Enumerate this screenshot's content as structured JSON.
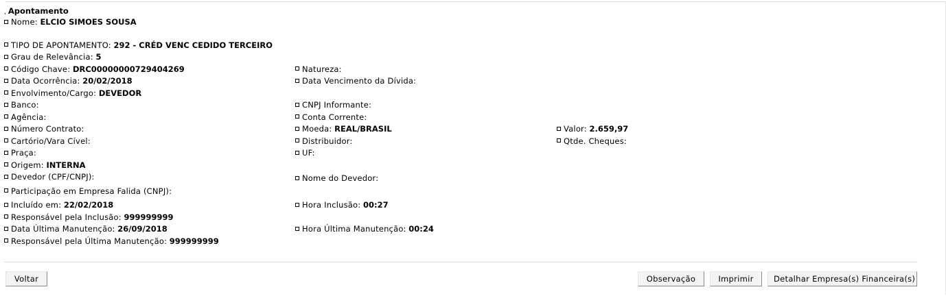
{
  "section_title": "Apontamento",
  "nome": {
    "label": "Nome:",
    "value": "ELCIO SIMOES SOUSA"
  },
  "tipo": {
    "label": "TIPO DE APONTAMENTO:",
    "value": "292 - CRÉD VENC CEDIDO TERCEIRO"
  },
  "grau": {
    "label": "Grau de Relevância:",
    "value": "5"
  },
  "codigo": {
    "label": "Código Chave:",
    "value": "DRC00000000729404269"
  },
  "natureza": {
    "label": "Natureza:",
    "value": ""
  },
  "data_ocorrencia": {
    "label": "Data Ocorrência:",
    "value": "20/02/2018"
  },
  "data_vencimento": {
    "label": "Data Vencimento da Dívida:",
    "value": ""
  },
  "envolvimento": {
    "label": "Envolvimento/Cargo:",
    "value": "DEVEDOR"
  },
  "banco": {
    "label": "Banco:",
    "value": ""
  },
  "cnpj_informante": {
    "label": "CNPJ Informante:",
    "value": ""
  },
  "agencia": {
    "label": "Agência:",
    "value": ""
  },
  "conta_corrente": {
    "label": "Conta Corrente:",
    "value": ""
  },
  "numero_contrato": {
    "label": "Número Contrato:",
    "value": ""
  },
  "moeda": {
    "label": "Moeda:",
    "value": "REAL/BRASIL"
  },
  "valor": {
    "label": "Valor:",
    "value": "2.659,97"
  },
  "cartorio": {
    "label": "Cartório/Vara Cível:",
    "value": ""
  },
  "distribuidor": {
    "label": "Distribuidor:",
    "value": ""
  },
  "qtde_cheques": {
    "label": "Qtde. Cheques:",
    "value": ""
  },
  "praca": {
    "label": "Praça:",
    "value": ""
  },
  "uf": {
    "label": "UF:",
    "value": ""
  },
  "origem": {
    "label": "Origem:",
    "value": "INTERNA"
  },
  "devedor_cpf": {
    "label": "Devedor (CPF/CNPJ):",
    "value": ""
  },
  "nome_devedor": {
    "label": "Nome do Devedor:",
    "value": ""
  },
  "participacao": {
    "label": "Participação em Empresa Falida (CNPJ):",
    "value": ""
  },
  "incluido_em": {
    "label": "Incluído em:",
    "value": "22/02/2018"
  },
  "hora_inclusao": {
    "label": "Hora Inclusão:",
    "value": "00:27"
  },
  "resp_inclusao": {
    "label": "Responsável pela Inclusão:",
    "value": "999999999"
  },
  "data_ultima_manut": {
    "label": "Data Última Manutenção:",
    "value": "26/09/2018"
  },
  "hora_ultima_manut": {
    "label": "Hora Última Manutenção:",
    "value": "00:24"
  },
  "resp_ultima_manut": {
    "label": "Responsável pela Última Manutenção:",
    "value": "999999999"
  },
  "buttons": {
    "voltar": "Voltar",
    "observacao": "Observação",
    "imprimir": "Imprimir",
    "detalhar": "Detalhar Empresa(s) Financeira(s)"
  }
}
